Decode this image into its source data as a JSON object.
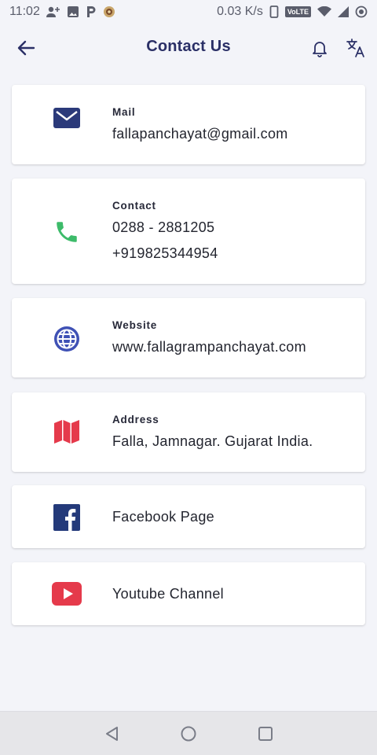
{
  "status_bar": {
    "time": "11:02",
    "speed": "0.03 K/s",
    "lte": "VoLTE"
  },
  "app_bar": {
    "title": "Contact Us"
  },
  "cards": {
    "mail": {
      "label": "Mail",
      "value": "fallapanchayat@gmail.com",
      "icon": "mail-icon",
      "color": "#2b3a7a"
    },
    "contact": {
      "label": "Contact",
      "phone1": "0288 - 2881205",
      "phone2": "+919825344954",
      "icon": "phone-icon",
      "color": "#3dbb6a"
    },
    "website": {
      "label": "Website",
      "value": "www.fallagrampanchayat.com",
      "icon": "globe-icon",
      "color": "#3f51b5"
    },
    "address": {
      "label": "Address",
      "value": "Falla, Jamnagar. Gujarat India.",
      "icon": "map-icon",
      "color": "#e53a4b"
    },
    "facebook": {
      "value": "Facebook Page",
      "icon": "facebook-icon",
      "color": "#243a7a"
    },
    "youtube": {
      "value": "Youtube Channel",
      "icon": "youtube-icon",
      "color": "#e53a4b"
    }
  }
}
